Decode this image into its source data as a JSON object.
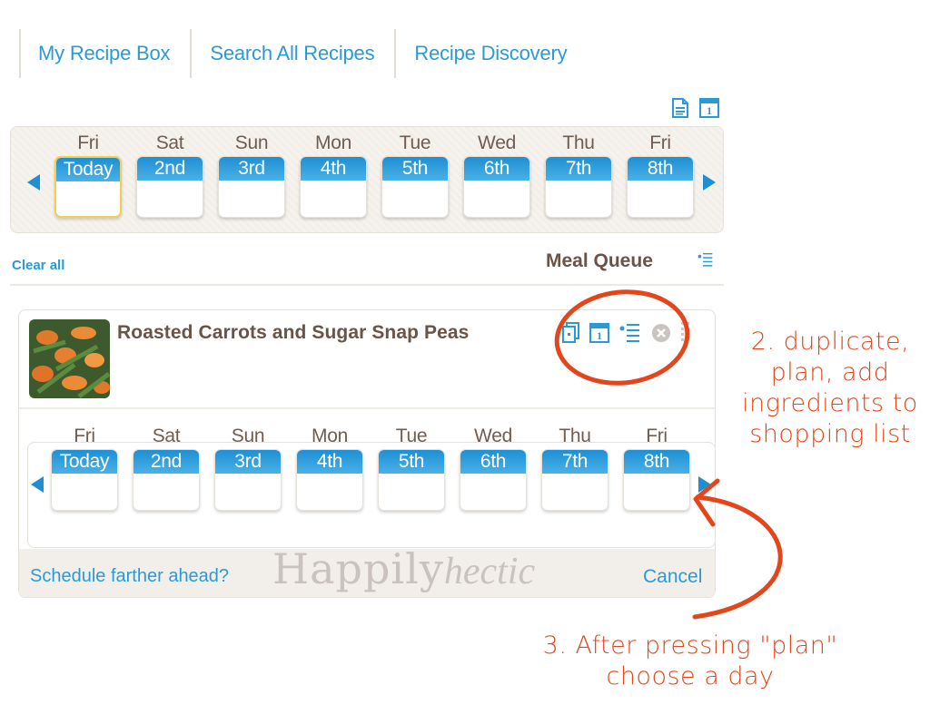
{
  "nav": {
    "tabs": [
      {
        "label": "My Recipe Box"
      },
      {
        "label": "Search All Recipes"
      },
      {
        "label": "Recipe Discovery"
      }
    ]
  },
  "top_icons": [
    {
      "name": "shopping-list-icon"
    },
    {
      "name": "calendar-icon",
      "glyph": "1"
    }
  ],
  "planner": {
    "days": [
      {
        "weekday": "Fri",
        "date": "Today",
        "is_today": true
      },
      {
        "weekday": "Sat",
        "date": "2nd"
      },
      {
        "weekday": "Sun",
        "date": "3rd"
      },
      {
        "weekday": "Mon",
        "date": "4th"
      },
      {
        "weekday": "Tue",
        "date": "5th"
      },
      {
        "weekday": "Wed",
        "date": "6th"
      },
      {
        "weekday": "Thu",
        "date": "7th"
      },
      {
        "weekday": "Fri",
        "date": "8th"
      }
    ]
  },
  "meal_queue": {
    "clear_all_label": "Clear all",
    "title": "Meal Queue",
    "recipe": {
      "title": "Roasted Carrots and Sugar Snap Peas",
      "actions": [
        "duplicate",
        "plan",
        "add-ingredients-to-shopping-list",
        "remove"
      ],
      "calendar_glyph": "1",
      "schedule_link": "Schedule farther ahead?",
      "cancel_label": "Cancel"
    }
  },
  "watermark": {
    "part1": "Happily",
    "part2": "hectic"
  },
  "annotations": {
    "step2": [
      "2. duplicate,",
      "plan, add",
      "ingredients to",
      "shopping list"
    ],
    "step3": [
      "3. After pressing \"plan\"",
      "choose a day"
    ]
  },
  "colors": {
    "link_blue": "#2a9ad6",
    "day_header_blue": "#1e8fd3",
    "title_brown": "#6a5447",
    "annotation_red": "#e4461b",
    "today_border": "#f1cf52"
  }
}
